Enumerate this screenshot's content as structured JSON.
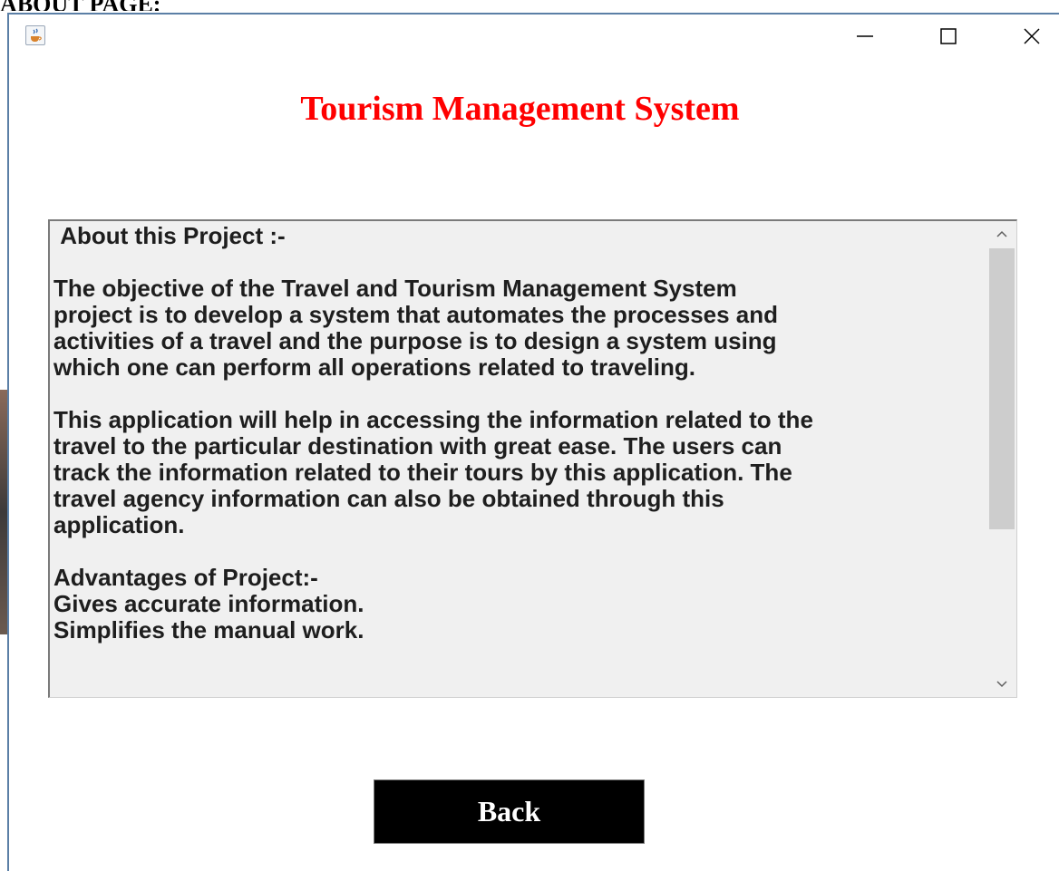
{
  "doc_heading": "ABOUT PAGE:",
  "window": {
    "minimize_glyph": "—",
    "app_icon": "java-cup-icon",
    "controls": [
      "minimize-icon",
      "maximize-icon",
      "close-icon"
    ]
  },
  "app_title": "Tourism Management System",
  "colors": {
    "title": "#ff0000",
    "button_bg": "#000000",
    "button_text": "#ffffff",
    "text_area_bg": "#f0f0f0",
    "window_border": "#5b7fa6"
  },
  "about_text": {
    "heading": " About this Project :-",
    "paragraph1_lines": [
      "The objective of the Travel and Tourism Management System",
      "project is to develop a system that automates the processes and",
      "activities of a travel and the purpose is to design a system using",
      "which one can perform all operations related to traveling."
    ],
    "paragraph2_lines": [
      "This application will help in accessing the information related to the",
      "travel to the particular destination with great ease. The users can",
      "track the information related to their tours by this application. The",
      "travel agency information can also be obtained through this",
      "application."
    ],
    "advantages_heading": "Advantages of Project:-",
    "advantages": [
      "Gives accurate information.",
      "Simplifies the manual work."
    ]
  },
  "scrollbar": {
    "up_icon": "chevron-up-icon",
    "down_icon": "chevron-down-icon",
    "position_fraction": 0.0
  },
  "back_button": {
    "label": "Back"
  }
}
